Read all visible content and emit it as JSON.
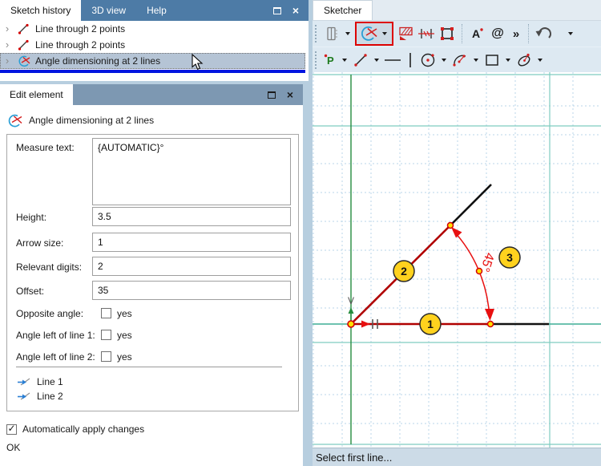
{
  "colors": {
    "history_titlebar": "#4d7ba6",
    "edit_titlebar": "#7d98b2",
    "selected_row_bg": "#b5c4d5",
    "selection_divider_blue": "#0016e0",
    "toolbar_bg": "#dde9f2",
    "active_tool_border": "#dd0000",
    "axis_green": "#268c3e",
    "axis_teal": "#3fae96",
    "line_red": "#b00000",
    "dimension_red": "#e81010",
    "marker_yellow": "#ffd21e",
    "grid_blue": "#b9d6e8",
    "grid_major_teal": "#7fccc0"
  },
  "history_panel": {
    "tabs": [
      {
        "label": "Sketch history",
        "active": true
      },
      {
        "label": "3D view",
        "active": false
      },
      {
        "label": "Help",
        "active": false
      }
    ],
    "items": [
      {
        "label": "Line through 2 points",
        "icon": "line-icon",
        "selected": false
      },
      {
        "label": "Line through 2 points",
        "icon": "line-icon",
        "selected": false
      },
      {
        "label": "Angle dimensioning at 2 lines",
        "icon": "angle-dimension-icon",
        "selected": true
      }
    ]
  },
  "edit_panel": {
    "title_tab": "Edit element",
    "element_header": "Angle dimensioning at 2 lines",
    "fields": [
      {
        "label": "Measure text:",
        "value": "{AUTOMATIC}°"
      },
      {
        "label": "Height:",
        "value": "3.5"
      },
      {
        "label": "Arrow size:",
        "value": "1"
      },
      {
        "label": "Relevant digits:",
        "value": "2"
      },
      {
        "label": "Offset:",
        "value": "35"
      }
    ],
    "checkboxes": [
      {
        "label": "Opposite angle:",
        "option": "yes",
        "checked": false
      },
      {
        "label": "Angle left of line 1:",
        "option": "yes",
        "checked": false
      },
      {
        "label": "Angle left of line 2:",
        "option": "yes",
        "checked": false
      }
    ],
    "line_refs": [
      {
        "label": "Line 1",
        "icon": "select-line-icon"
      },
      {
        "label": "Line 2",
        "icon": "select-line-icon"
      }
    ],
    "auto_apply": {
      "label": "Automatically apply changes",
      "checked": true
    },
    "ok_label": "OK"
  },
  "sketcher_panel": {
    "tab": "Sketcher",
    "toolbar_row1": [
      {
        "icon": "projection-icon",
        "dropdown": true,
        "active": false
      },
      {
        "icon": "angle-dimension-icon",
        "dropdown": true,
        "active": true
      },
      {
        "icon": "hatch-icon",
        "dropdown": false,
        "active": false
      },
      {
        "icon": "distance-dimension-icon",
        "dropdown": false,
        "active": false
      },
      {
        "icon": "frame-corners-icon",
        "dropdown": false,
        "active": false
      },
      {
        "icon": "text-icon",
        "dropdown": false,
        "active": false
      },
      {
        "icon": "symbol-at-icon",
        "dropdown": false,
        "active": false
      },
      {
        "icon": "more-tools-icon",
        "dropdown": false,
        "active": false
      },
      {
        "icon": "undo-icon",
        "dropdown": true,
        "active": false
      }
    ],
    "toolbar_row1_glyphs": {
      "at_sign": "@",
      "more": "»"
    },
    "toolbar_row2": [
      {
        "icon": "point-icon",
        "dropdown": true
      },
      {
        "icon": "line-icon",
        "dropdown": true
      },
      {
        "icon": "horizontal-line-icon",
        "dropdown": false
      },
      {
        "icon": "vertical-line-icon",
        "dropdown": false
      },
      {
        "icon": "circle-icon",
        "dropdown": true
      },
      {
        "icon": "arc-icon",
        "dropdown": true
      },
      {
        "icon": "rectangle-icon",
        "dropdown": true
      },
      {
        "icon": "ellipse-icon",
        "dropdown": true
      }
    ],
    "status": "Select first line...",
    "canvas": {
      "angle_label": "45°",
      "axis_vertical_label": "V",
      "markers": [
        {
          "text": "1"
        },
        {
          "text": "2"
        },
        {
          "text": "3"
        }
      ]
    }
  }
}
